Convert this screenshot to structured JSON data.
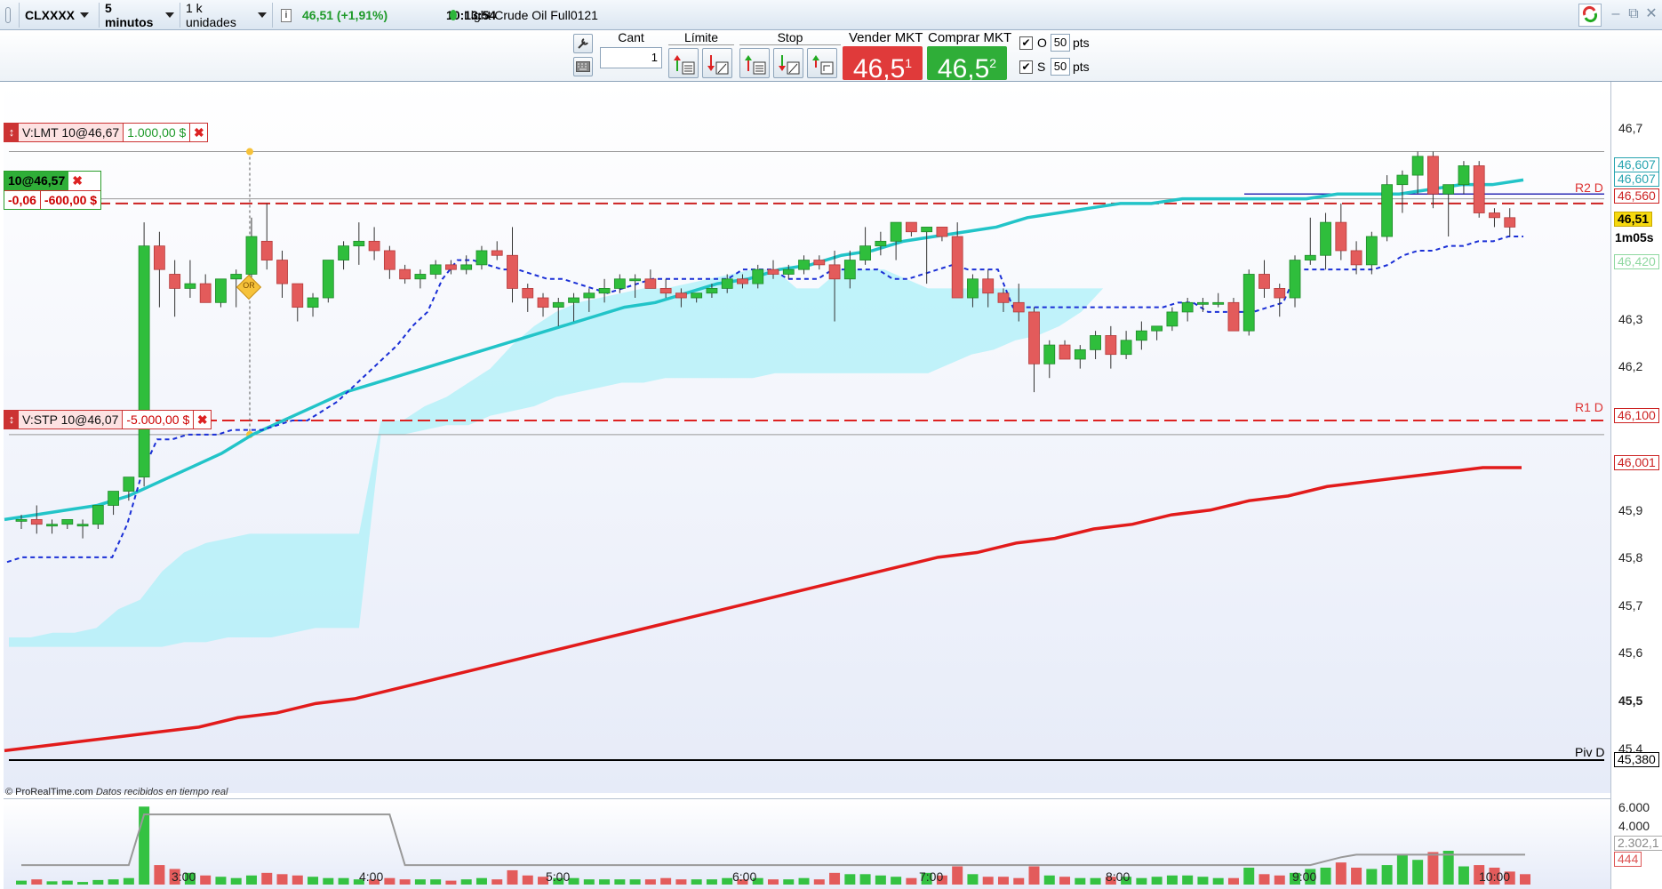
{
  "topbar": {
    "symbol": "CLXXXX",
    "timeframe": "5 minutos",
    "units": "1 k unidades",
    "price_change": "46,51 (+1,91%)",
    "clock": "10:13:54",
    "instrument": "Light Crude Oil Full0121",
    "status_color": "#2db53a"
  },
  "order_panel": {
    "qty_label": "Cant",
    "qty_value": "1",
    "limit_label": "Límite",
    "stop_label": "Stop",
    "sell_label": "Vender MKT",
    "sell_price": "46,5",
    "sell_price_sup": "1",
    "buy_label": "Comprar MKT",
    "buy_price": "46,5",
    "buy_price_sup": "2",
    "o_label": "O",
    "o_value": "50",
    "s_label": "S",
    "s_value": "50",
    "pts": "pts",
    "sell_color": "#e03a3a",
    "buy_color": "#2fae38"
  },
  "orders": {
    "limit": {
      "text": "V:LMT 10@46,67",
      "pl": "1.000,00 $"
    },
    "stop": {
      "text": "V:STP 10@46,07",
      "pl": "-5.000,00 $"
    },
    "position": {
      "qty": "10@46,57",
      "pts": "-0,06",
      "pl": "-600,00 $"
    }
  },
  "annotation": "OR",
  "chart_data": {
    "type": "candlestick",
    "x_ticks": [
      "3:00",
      "4:00",
      "5:00",
      "6:00",
      "7:00",
      "8:00",
      "9:00",
      "10:00"
    ],
    "y_ticks": [
      "46,7",
      "46,3",
      "46,2",
      "45,9",
      "45,8",
      "45,7",
      "45,6",
      "45,5",
      "45,4"
    ],
    "y_range": [
      45.38,
      46.72
    ],
    "level_labels": {
      "r2": "R2 D",
      "r1": "R1 D",
      "piv": "Piv D"
    },
    "price_badges": {
      "b1": "46,607",
      "b2": "46,607",
      "b3": "46,560",
      "b4": "46,51",
      "b5": "46,420",
      "b6": "46,100",
      "b7": "46,001",
      "b8": "45,380"
    },
    "bar_timer": "1m05s",
    "volume_ticks": [
      "6.000",
      "4.000",
      "2.302,1",
      "444"
    ],
    "candles": [
      [
        45.89,
        45.9,
        45.87,
        45.89
      ],
      [
        45.89,
        45.92,
        45.86,
        45.88
      ],
      [
        45.88,
        45.89,
        45.86,
        45.88
      ],
      [
        45.88,
        45.89,
        45.87,
        45.89
      ],
      [
        45.88,
        45.89,
        45.85,
        45.88
      ],
      [
        45.88,
        45.91,
        45.87,
        45.92
      ],
      [
        45.92,
        45.93,
        45.9,
        45.95
      ],
      [
        45.95,
        45.97,
        45.93,
        45.98
      ],
      [
        45.98,
        46.52,
        45.96,
        46.47
      ],
      [
        46.47,
        46.5,
        46.34,
        46.42
      ],
      [
        46.41,
        46.44,
        46.32,
        46.38
      ],
      [
        46.38,
        46.44,
        46.36,
        46.39
      ],
      [
        46.39,
        46.41,
        46.35,
        46.35
      ],
      [
        46.35,
        46.4,
        46.34,
        46.4
      ],
      [
        46.4,
        46.42,
        46.34,
        46.41
      ],
      [
        46.41,
        46.53,
        46.39,
        46.49
      ],
      [
        46.48,
        46.56,
        46.42,
        46.44
      ],
      [
        46.44,
        46.46,
        46.36,
        46.39
      ],
      [
        46.39,
        46.39,
        46.31,
        46.34
      ],
      [
        46.34,
        46.37,
        46.32,
        46.36
      ],
      [
        46.36,
        46.44,
        46.35,
        46.44
      ],
      [
        46.44,
        46.48,
        46.42,
        46.47
      ],
      [
        46.47,
        46.52,
        46.43,
        46.48
      ],
      [
        46.48,
        46.51,
        46.44,
        46.46
      ],
      [
        46.46,
        46.47,
        46.4,
        46.42
      ],
      [
        46.42,
        46.43,
        46.39,
        46.4
      ],
      [
        46.4,
        46.42,
        46.38,
        46.41
      ],
      [
        46.41,
        46.44,
        46.4,
        46.43
      ],
      [
        46.43,
        46.44,
        46.41,
        46.42
      ],
      [
        46.42,
        46.45,
        46.41,
        46.43
      ],
      [
        46.43,
        46.47,
        46.42,
        46.46
      ],
      [
        46.46,
        46.48,
        46.44,
        46.45
      ],
      [
        46.45,
        46.51,
        46.35,
        46.38
      ],
      [
        46.38,
        46.39,
        46.33,
        46.36
      ],
      [
        46.36,
        46.37,
        46.32,
        46.34
      ],
      [
        46.34,
        46.36,
        46.3,
        46.35
      ],
      [
        46.35,
        46.37,
        46.31,
        46.36
      ],
      [
        46.36,
        46.38,
        46.33,
        46.37
      ],
      [
        46.37,
        46.4,
        46.35,
        46.38
      ],
      [
        46.38,
        46.41,
        46.37,
        46.4
      ],
      [
        46.4,
        46.41,
        46.36,
        46.4
      ],
      [
        46.4,
        46.42,
        46.38,
        46.38
      ],
      [
        46.38,
        46.4,
        46.36,
        46.37
      ],
      [
        46.37,
        46.38,
        46.34,
        46.36
      ],
      [
        46.36,
        46.37,
        46.35,
        46.37
      ],
      [
        46.37,
        46.39,
        46.36,
        46.38
      ],
      [
        46.38,
        46.41,
        46.37,
        46.4
      ],
      [
        46.4,
        46.41,
        46.38,
        46.39
      ],
      [
        46.39,
        46.43,
        46.38,
        46.42
      ],
      [
        46.42,
        46.44,
        46.4,
        46.41
      ],
      [
        46.41,
        46.43,
        46.4,
        46.42
      ],
      [
        46.42,
        46.45,
        46.41,
        46.44
      ],
      [
        46.44,
        46.45,
        46.42,
        46.43
      ],
      [
        46.43,
        46.46,
        46.31,
        46.4
      ],
      [
        46.4,
        46.46,
        46.38,
        46.44
      ],
      [
        46.44,
        46.51,
        46.43,
        46.47
      ],
      [
        46.47,
        46.5,
        46.45,
        46.48
      ],
      [
        46.48,
        46.5,
        46.44,
        46.52
      ],
      [
        46.52,
        46.51,
        46.49,
        46.5
      ],
      [
        46.5,
        46.51,
        46.39,
        46.51
      ],
      [
        46.51,
        46.51,
        46.48,
        46.49
      ],
      [
        46.49,
        46.52,
        46.36,
        46.36
      ],
      [
        46.36,
        46.41,
        46.34,
        46.4
      ],
      [
        46.4,
        46.42,
        46.34,
        46.37
      ],
      [
        46.37,
        46.38,
        46.33,
        46.35
      ],
      [
        46.35,
        46.39,
        46.31,
        46.33
      ],
      [
        46.33,
        46.34,
        46.16,
        46.22
      ],
      [
        46.22,
        46.27,
        46.19,
        46.26
      ],
      [
        46.26,
        46.27,
        46.23,
        46.23
      ],
      [
        46.23,
        46.26,
        46.21,
        46.25
      ],
      [
        46.25,
        46.29,
        46.23,
        46.28
      ],
      [
        46.28,
        46.3,
        46.21,
        46.24
      ],
      [
        46.24,
        46.29,
        46.23,
        46.27
      ],
      [
        46.27,
        46.31,
        46.25,
        46.29
      ],
      [
        46.29,
        46.3,
        46.27,
        46.3
      ],
      [
        46.3,
        46.34,
        46.29,
        46.33
      ],
      [
        46.33,
        46.36,
        46.31,
        46.35
      ],
      [
        46.35,
        46.36,
        46.33,
        46.35
      ],
      [
        46.35,
        46.37,
        46.34,
        46.35
      ],
      [
        46.35,
        46.36,
        46.29,
        46.29
      ],
      [
        46.29,
        46.42,
        46.28,
        46.41
      ],
      [
        46.41,
        46.44,
        46.36,
        46.38
      ],
      [
        46.38,
        46.39,
        46.32,
        46.36
      ],
      [
        46.36,
        46.45,
        46.34,
        46.44
      ],
      [
        46.44,
        46.53,
        46.43,
        46.45
      ],
      [
        46.45,
        46.54,
        46.42,
        46.52
      ],
      [
        46.52,
        46.56,
        46.44,
        46.46
      ],
      [
        46.46,
        46.48,
        46.41,
        46.43
      ],
      [
        46.43,
        46.5,
        46.41,
        46.49
      ],
      [
        46.49,
        46.62,
        46.48,
        46.6
      ],
      [
        46.6,
        46.63,
        46.54,
        46.62
      ],
      [
        46.62,
        46.67,
        46.58,
        46.66
      ],
      [
        46.66,
        46.67,
        46.55,
        46.58
      ],
      [
        46.58,
        46.6,
        46.49,
        46.6
      ],
      [
        46.6,
        46.65,
        46.58,
        46.64
      ],
      [
        46.64,
        46.65,
        46.53,
        46.54
      ],
      [
        46.54,
        46.55,
        46.51,
        46.53
      ],
      [
        46.53,
        46.55,
        46.49,
        46.51
      ]
    ],
    "ichimoku_top": [
      45.64,
      45.64,
      45.65,
      45.65,
      45.66,
      45.7,
      45.72,
      45.78,
      45.82,
      45.84,
      45.85,
      45.86,
      45.86,
      45.86,
      45.86,
      45.86,
      45.86,
      46.1,
      46.1,
      46.13,
      46.15,
      46.18,
      46.21,
      46.26,
      46.3,
      46.33,
      46.35,
      46.36,
      46.37,
      46.38,
      46.38,
      46.39,
      46.4,
      46.41,
      46.42,
      46.42,
      46.38,
      46.38,
      46.42,
      46.42,
      46.42,
      46.4,
      46.38,
      46.38,
      46.38,
      46.38,
      46.38,
      46.38,
      46.38,
      46.38,
      46.38,
      46.42,
      46.42,
      46.42
    ],
    "ichimoku_bottom": [
      45.62,
      45.62,
      45.62,
      45.62,
      45.62,
      45.62,
      45.62,
      45.62,
      45.63,
      45.63,
      45.64,
      45.64,
      45.64,
      45.65,
      45.66,
      45.66,
      45.66,
      46.07,
      46.07,
      46.08,
      46.09,
      46.09,
      46.11,
      46.12,
      46.13,
      46.15,
      46.16,
      46.17,
      46.18,
      46.18,
      46.19,
      46.19,
      46.19,
      46.19,
      46.19,
      46.2,
      46.2,
      46.2,
      46.2,
      46.2,
      46.2,
      46.2,
      46.2,
      46.22,
      46.24,
      46.25,
      46.27,
      46.28,
      46.3,
      46.33,
      46.38,
      46.42,
      46.42,
      46.42
    ],
    "ma_fast": [
      45.89,
      45.9,
      45.91,
      45.92,
      45.94,
      45.97,
      46.0,
      46.03,
      46.07,
      46.1,
      46.13,
      46.16,
      46.18,
      46.2,
      46.22,
      46.24,
      46.26,
      46.28,
      46.3,
      46.32,
      46.34,
      46.35,
      46.37,
      46.39,
      46.4,
      46.42,
      46.43,
      46.45,
      46.46,
      46.48,
      46.49,
      46.5,
      46.51,
      46.53,
      46.54,
      46.55,
      46.56,
      46.56,
      46.57,
      46.57,
      46.57,
      46.57,
      46.57,
      46.58,
      46.58,
      46.58,
      46.59,
      46.6,
      46.6,
      46.61
    ],
    "ma_slow": [
      45.4,
      45.41,
      45.42,
      45.43,
      45.44,
      45.45,
      45.47,
      45.48,
      45.5,
      45.51,
      45.53,
      45.55,
      45.57,
      45.59,
      45.61,
      45.63,
      45.65,
      45.67,
      45.69,
      45.71,
      45.73,
      45.75,
      45.77,
      45.79,
      45.81,
      45.82,
      45.84,
      45.85,
      45.87,
      45.88,
      45.9,
      45.91,
      45.93,
      45.94,
      45.96,
      45.97,
      45.98,
      45.99,
      46.0,
      46.0
    ],
    "dots_line": [
      45.8,
      45.81,
      45.81,
      45.81,
      45.81,
      45.81,
      45.81,
      45.81,
      45.88,
      45.99,
      46.06,
      46.06,
      46.07,
      46.07,
      46.07,
      46.08,
      46.08,
      46.08,
      46.09,
      46.1,
      46.1,
      46.12,
      46.14,
      46.17,
      46.2,
      46.23,
      46.26,
      46.3,
      46.33,
      46.4,
      46.44,
      46.44,
      46.43,
      46.42,
      46.42,
      46.41,
      46.4,
      46.4,
      46.39,
      46.38,
      46.37,
      46.38,
      46.39,
      46.4,
      46.4,
      46.4,
      46.4,
      46.4,
      46.4,
      46.42,
      46.42,
      46.42,
      46.4,
      46.4,
      46.4,
      46.42,
      46.42,
      46.42,
      46.42,
      46.4,
      46.4,
      46.41,
      46.42,
      46.43,
      46.42,
      46.42,
      46.42,
      46.34,
      46.34,
      46.34,
      46.34,
      46.34,
      46.34,
      46.34,
      46.34,
      46.34,
      46.34,
      46.34,
      46.35,
      46.35,
      46.33,
      46.33,
      46.33,
      46.33,
      46.34,
      46.35,
      46.42,
      46.42,
      46.42,
      46.42,
      46.42,
      46.42,
      46.43,
      46.45,
      46.46,
      46.46,
      46.47,
      46.47,
      46.48,
      46.48,
      46.49,
      46.49
    ],
    "volume": [
      300,
      400,
      250,
      300,
      200,
      350,
      400,
      500,
      6000,
      1500,
      1200,
      900,
      700,
      600,
      500,
      700,
      900,
      800,
      700,
      600,
      500,
      500,
      400,
      400,
      500,
      400,
      400,
      400,
      300,
      400,
      500,
      400,
      1100,
      700,
      600,
      500,
      500,
      400,
      400,
      400,
      400,
      400,
      500,
      400,
      400,
      400,
      500,
      400,
      500,
      400,
      400,
      500,
      400,
      900,
      800,
      800,
      700,
      600,
      500,
      900,
      700,
      1400,
      800,
      600,
      600,
      500,
      1400,
      700,
      600,
      500,
      500,
      600,
      600,
      500,
      600,
      700,
      700,
      600,
      500,
      500,
      1300,
      800,
      700,
      900,
      1200,
      1300,
      1700,
      1300,
      1200,
      1500,
      2300,
      1900,
      2500,
      2600,
      1400,
      1500,
      1300,
      1000,
      800
    ],
    "volume_avg_line": [
      1500,
      1500,
      1500,
      1500,
      1500,
      1500,
      1500,
      1500,
      5400,
      5400,
      5400,
      5400,
      5400,
      5400,
      5400,
      5400,
      5400,
      5400,
      5400,
      5400,
      5400,
      5400,
      5400,
      5400,
      5400,
      1500,
      1500,
      1500,
      1500,
      1500,
      1500,
      1500,
      1500,
      1500,
      1500,
      1500,
      1500,
      1500,
      1500,
      1500,
      1500,
      1500,
      1500,
      1500,
      1500,
      1500,
      1500,
      1500,
      1500,
      1500,
      1500,
      1500,
      1500,
      1500,
      1500,
      1500,
      1500,
      1500,
      1500,
      1500,
      1500,
      1500,
      1500,
      1500,
      1500,
      1500,
      1500,
      1500,
      1500,
      1500,
      1500,
      1500,
      1500,
      1500,
      1500,
      1500,
      1500,
      1500,
      1500,
      1500,
      1500,
      1500,
      1500,
      1500,
      1500,
      1800,
      2100,
      2300,
      2300,
      2300,
      2300,
      2300,
      2300,
      2300,
      2300,
      2300,
      2300,
      2300,
      2300
    ]
  },
  "footer": {
    "copyright": "© ProRealTime.com",
    "realtime": "Datos recibidos en tiempo real"
  }
}
